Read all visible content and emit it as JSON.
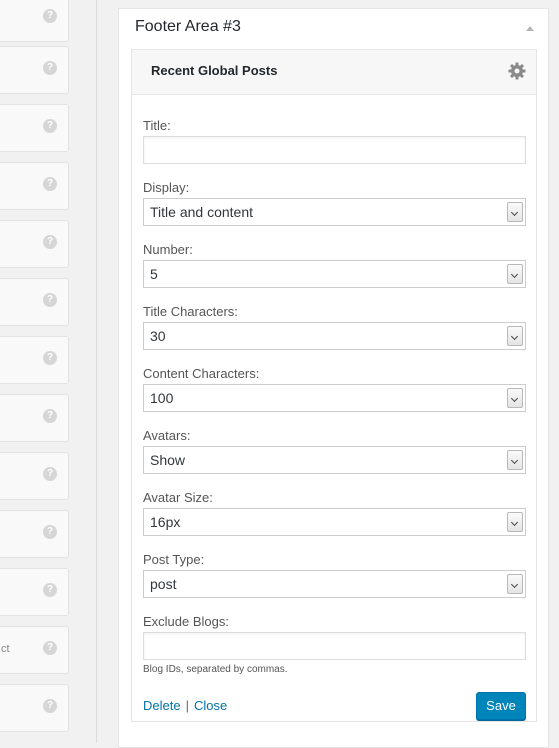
{
  "left_column": {
    "help_glyph": "?",
    "stub_text": "ct"
  },
  "sidebar": {
    "title": "Footer Area #3"
  },
  "widget": {
    "title": "Recent Global Posts",
    "fields": {
      "title": {
        "label": "Title:",
        "value": ""
      },
      "display": {
        "label": "Display:",
        "value": "Title and content"
      },
      "number": {
        "label": "Number:",
        "value": "5"
      },
      "title_characters": {
        "label": "Title Characters:",
        "value": "30"
      },
      "content_characters": {
        "label": "Content Characters:",
        "value": "100"
      },
      "avatars": {
        "label": "Avatars:",
        "value": "Show"
      },
      "avatar_size": {
        "label": "Avatar Size:",
        "value": "16px"
      },
      "post_type": {
        "label": "Post Type:",
        "value": "post"
      },
      "exclude_blogs": {
        "label": "Exclude Blogs:",
        "value": "",
        "hint": "Blog IDs, separated by commas."
      }
    },
    "actions": {
      "delete_label": "Delete",
      "separator": "|",
      "close_label": "Close",
      "save_label": "Save"
    }
  },
  "colors": {
    "accent": "#0085ba",
    "link": "#0073aa"
  }
}
